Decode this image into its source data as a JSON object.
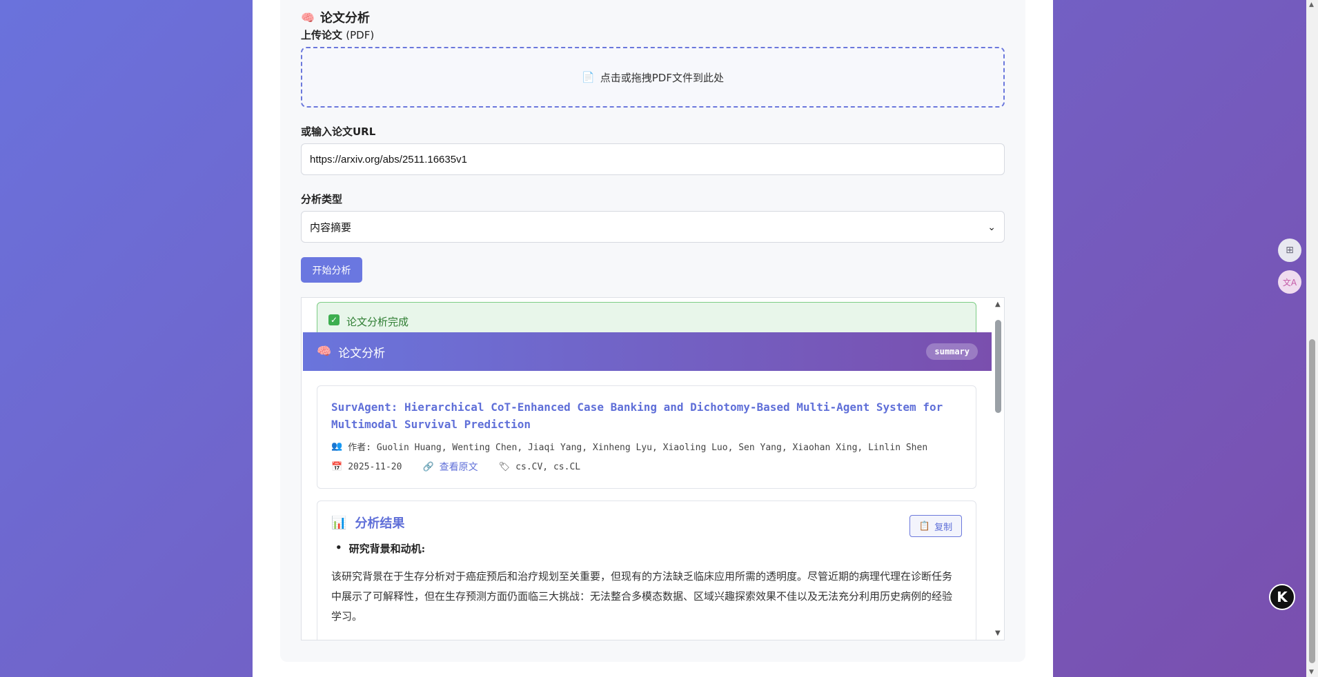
{
  "section": {
    "icon": "brain-icon",
    "title": "论文分析"
  },
  "upload": {
    "label_main": "上传论文",
    "label_suffix": "(PDF)",
    "drop_text": "点击或拖拽PDF文件到此处",
    "drop_icon": "document-icon"
  },
  "url": {
    "label": "或输入论文URL",
    "value": "https://arxiv.org/abs/2511.16635v1"
  },
  "analysis_type": {
    "label": "分析类型",
    "selected": "内容摘要"
  },
  "start_button": "开始分析",
  "result": {
    "success_text": "论文分析完成",
    "header_title": "论文分析",
    "badge": "summary",
    "paper": {
      "title": "SurvAgent: Hierarchical CoT-Enhanced Case Banking and Dichotomy-Based Multi-Agent System for Multimodal Survival Prediction",
      "authors": "作者: Guolin Huang, Wenting Chen, Jiaqi Yang, Xinheng Lyu, Xiaoling Luo, Sen Yang, Xiaohan Xing, Linlin Shen",
      "date": "2025-11-20",
      "link_text": "查看原文",
      "categories": "cs.CV, cs.CL"
    },
    "analysis": {
      "title": "分析结果",
      "copy_label": "复制",
      "bullet": "研究背景和动机:",
      "paragraph": "该研究背景在于生存分析对于癌症预后和治疗规划至关重要，但现有的方法缺乏临床应用所需的透明度。尽管近期的病理代理在诊断任务中展示了可解释性，但在生存预测方面仍面临三大挑战：无法整合多模态数据、区域兴趣探索效果不佳以及无法充分利用历史病例的经验学习。"
    }
  },
  "colors": {
    "accent": "#6a77e0",
    "success": "#2e7d32",
    "gradient_start": "#6a72dc",
    "gradient_end": "#7a4fae"
  }
}
